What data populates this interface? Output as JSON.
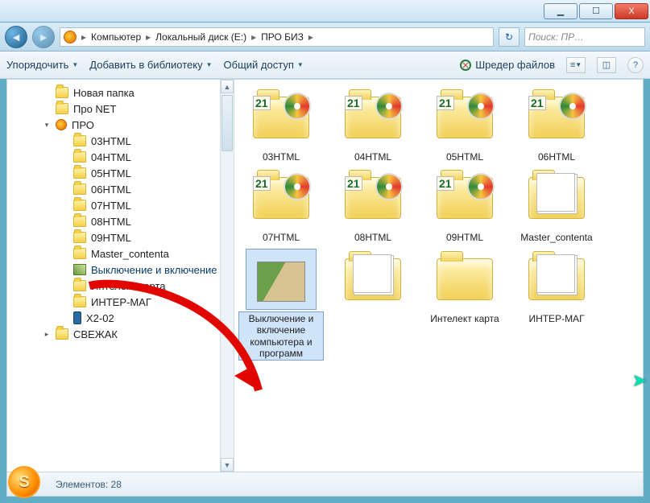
{
  "window_controls": {
    "min": "▁",
    "max": "☐",
    "close": "X"
  },
  "breadcrumb": {
    "root": "Компьютер",
    "drive": "Локальный диск (E:)",
    "folder": "ПРО БИЗ"
  },
  "search": {
    "placeholder": "Поиск: ПР…"
  },
  "toolbar": {
    "organize": "Упорядочить",
    "library": "Добавить в библиотеку",
    "share": "Общий доступ",
    "shredder": "Шредер файлов"
  },
  "tree": {
    "items": [
      {
        "label": "Новая папка",
        "icon": "folder",
        "level": 1
      },
      {
        "label": "Про NET",
        "icon": "folder",
        "level": 1
      },
      {
        "label": "ПРО",
        "icon": "orb",
        "level": 1,
        "expanded": true
      },
      {
        "label": "03HTML",
        "icon": "folder",
        "level": 2
      },
      {
        "label": "04HTML",
        "icon": "folder",
        "level": 2
      },
      {
        "label": "05HTML",
        "icon": "folder",
        "level": 2
      },
      {
        "label": "06HTML",
        "icon": "folder",
        "level": 2
      },
      {
        "label": "07HTML",
        "icon": "folder",
        "level": 2
      },
      {
        "label": "08HTML",
        "icon": "folder",
        "level": 2
      },
      {
        "label": "09HTML",
        "icon": "folder",
        "level": 2
      },
      {
        "label": "Master_contenta",
        "icon": "folder",
        "level": 2
      },
      {
        "label": "Выключение и включение",
        "icon": "img",
        "level": 2,
        "selected": true
      },
      {
        "label": "Интелект карта",
        "icon": "folder",
        "level": 2
      },
      {
        "label": "ИНТЕР-МАГ",
        "icon": "folder",
        "level": 2
      },
      {
        "label": "X2-02",
        "icon": "phone",
        "level": 2
      },
      {
        "label": "СВЕЖАК",
        "icon": "folder",
        "level": 1,
        "expander": true
      }
    ]
  },
  "grid": {
    "items": [
      {
        "label": "03HTML",
        "type": "disc"
      },
      {
        "label": "04HTML",
        "type": "disc"
      },
      {
        "label": "05HTML",
        "type": "disc"
      },
      {
        "label": "06HTML",
        "type": "disc"
      },
      {
        "label": "07HTML",
        "type": "disc"
      },
      {
        "label": "08HTML",
        "type": "disc"
      },
      {
        "label": "09HTML",
        "type": "disc"
      },
      {
        "label": "Master_contenta",
        "type": "sheets"
      },
      {
        "label": "Выключение и включение компьютера и программ",
        "type": "thumb",
        "selected": true
      },
      {
        "label": "",
        "type": "sheets"
      },
      {
        "label": "Интелект карта",
        "type": "folder"
      },
      {
        "label": "ИНТЕР-МАГ",
        "type": "sheets"
      }
    ]
  },
  "status": {
    "label": "Элементов:",
    "count": "28"
  }
}
